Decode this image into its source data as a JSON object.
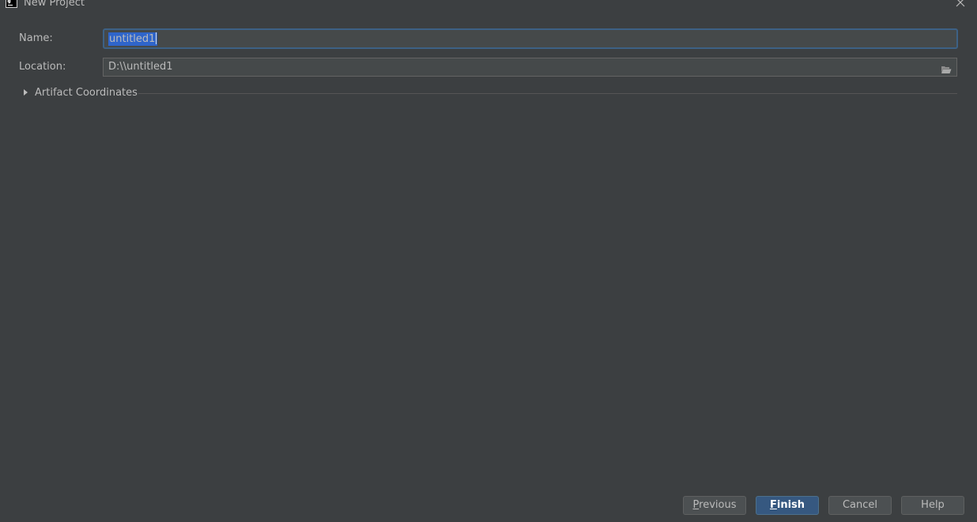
{
  "window": {
    "title": "New Project",
    "icon": "intellij-idea-icon"
  },
  "form": {
    "name_label": "Name:",
    "name_value": "untitled1",
    "location_label": "Location:",
    "location_value": "D:\\\\untitled1",
    "browse_icon": "folder-open-icon"
  },
  "section": {
    "label": "Artifact Coordinates",
    "expanded": false
  },
  "buttons": {
    "previous_mnemonic": "P",
    "previous_rest": "revious",
    "finish_mnemonic": "F",
    "finish_rest": "inish",
    "cancel": "Cancel",
    "help": "Help"
  },
  "colors": {
    "background": "#3c3f41",
    "field": "#45494a",
    "focus_border": "#3d6185",
    "selection": "#2f65ca",
    "default_button": "#365880"
  }
}
